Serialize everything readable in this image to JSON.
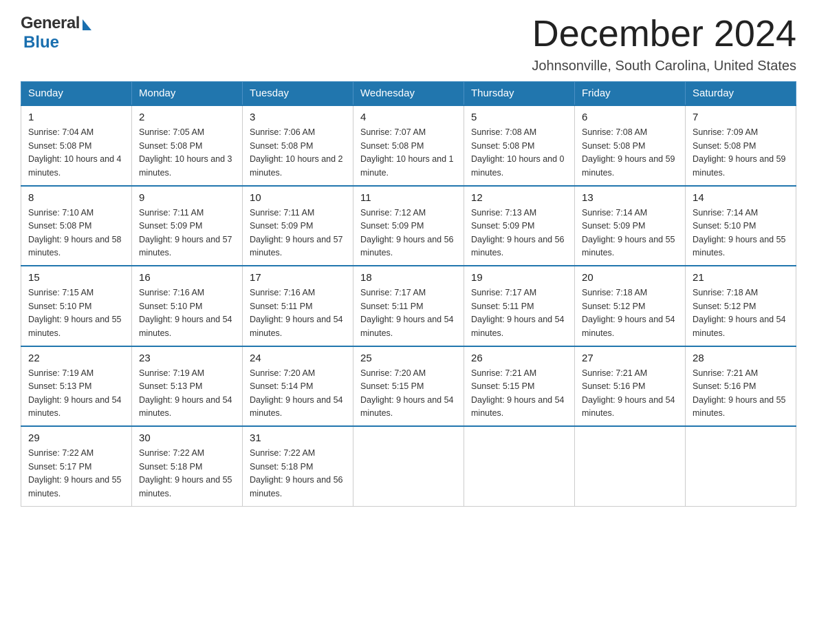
{
  "header": {
    "logo_general": "General",
    "logo_blue": "Blue",
    "month_year": "December 2024",
    "location": "Johnsonville, South Carolina, United States"
  },
  "weekdays": [
    "Sunday",
    "Monday",
    "Tuesday",
    "Wednesday",
    "Thursday",
    "Friday",
    "Saturday"
  ],
  "weeks": [
    [
      {
        "day": "1",
        "sunrise": "Sunrise: 7:04 AM",
        "sunset": "Sunset: 5:08 PM",
        "daylight": "Daylight: 10 hours and 4 minutes."
      },
      {
        "day": "2",
        "sunrise": "Sunrise: 7:05 AM",
        "sunset": "Sunset: 5:08 PM",
        "daylight": "Daylight: 10 hours and 3 minutes."
      },
      {
        "day": "3",
        "sunrise": "Sunrise: 7:06 AM",
        "sunset": "Sunset: 5:08 PM",
        "daylight": "Daylight: 10 hours and 2 minutes."
      },
      {
        "day": "4",
        "sunrise": "Sunrise: 7:07 AM",
        "sunset": "Sunset: 5:08 PM",
        "daylight": "Daylight: 10 hours and 1 minute."
      },
      {
        "day": "5",
        "sunrise": "Sunrise: 7:08 AM",
        "sunset": "Sunset: 5:08 PM",
        "daylight": "Daylight: 10 hours and 0 minutes."
      },
      {
        "day": "6",
        "sunrise": "Sunrise: 7:08 AM",
        "sunset": "Sunset: 5:08 PM",
        "daylight": "Daylight: 9 hours and 59 minutes."
      },
      {
        "day": "7",
        "sunrise": "Sunrise: 7:09 AM",
        "sunset": "Sunset: 5:08 PM",
        "daylight": "Daylight: 9 hours and 59 minutes."
      }
    ],
    [
      {
        "day": "8",
        "sunrise": "Sunrise: 7:10 AM",
        "sunset": "Sunset: 5:08 PM",
        "daylight": "Daylight: 9 hours and 58 minutes."
      },
      {
        "day": "9",
        "sunrise": "Sunrise: 7:11 AM",
        "sunset": "Sunset: 5:09 PM",
        "daylight": "Daylight: 9 hours and 57 minutes."
      },
      {
        "day": "10",
        "sunrise": "Sunrise: 7:11 AM",
        "sunset": "Sunset: 5:09 PM",
        "daylight": "Daylight: 9 hours and 57 minutes."
      },
      {
        "day": "11",
        "sunrise": "Sunrise: 7:12 AM",
        "sunset": "Sunset: 5:09 PM",
        "daylight": "Daylight: 9 hours and 56 minutes."
      },
      {
        "day": "12",
        "sunrise": "Sunrise: 7:13 AM",
        "sunset": "Sunset: 5:09 PM",
        "daylight": "Daylight: 9 hours and 56 minutes."
      },
      {
        "day": "13",
        "sunrise": "Sunrise: 7:14 AM",
        "sunset": "Sunset: 5:09 PM",
        "daylight": "Daylight: 9 hours and 55 minutes."
      },
      {
        "day": "14",
        "sunrise": "Sunrise: 7:14 AM",
        "sunset": "Sunset: 5:10 PM",
        "daylight": "Daylight: 9 hours and 55 minutes."
      }
    ],
    [
      {
        "day": "15",
        "sunrise": "Sunrise: 7:15 AM",
        "sunset": "Sunset: 5:10 PM",
        "daylight": "Daylight: 9 hours and 55 minutes."
      },
      {
        "day": "16",
        "sunrise": "Sunrise: 7:16 AM",
        "sunset": "Sunset: 5:10 PM",
        "daylight": "Daylight: 9 hours and 54 minutes."
      },
      {
        "day": "17",
        "sunrise": "Sunrise: 7:16 AM",
        "sunset": "Sunset: 5:11 PM",
        "daylight": "Daylight: 9 hours and 54 minutes."
      },
      {
        "day": "18",
        "sunrise": "Sunrise: 7:17 AM",
        "sunset": "Sunset: 5:11 PM",
        "daylight": "Daylight: 9 hours and 54 minutes."
      },
      {
        "day": "19",
        "sunrise": "Sunrise: 7:17 AM",
        "sunset": "Sunset: 5:11 PM",
        "daylight": "Daylight: 9 hours and 54 minutes."
      },
      {
        "day": "20",
        "sunrise": "Sunrise: 7:18 AM",
        "sunset": "Sunset: 5:12 PM",
        "daylight": "Daylight: 9 hours and 54 minutes."
      },
      {
        "day": "21",
        "sunrise": "Sunrise: 7:18 AM",
        "sunset": "Sunset: 5:12 PM",
        "daylight": "Daylight: 9 hours and 54 minutes."
      }
    ],
    [
      {
        "day": "22",
        "sunrise": "Sunrise: 7:19 AM",
        "sunset": "Sunset: 5:13 PM",
        "daylight": "Daylight: 9 hours and 54 minutes."
      },
      {
        "day": "23",
        "sunrise": "Sunrise: 7:19 AM",
        "sunset": "Sunset: 5:13 PM",
        "daylight": "Daylight: 9 hours and 54 minutes."
      },
      {
        "day": "24",
        "sunrise": "Sunrise: 7:20 AM",
        "sunset": "Sunset: 5:14 PM",
        "daylight": "Daylight: 9 hours and 54 minutes."
      },
      {
        "day": "25",
        "sunrise": "Sunrise: 7:20 AM",
        "sunset": "Sunset: 5:15 PM",
        "daylight": "Daylight: 9 hours and 54 minutes."
      },
      {
        "day": "26",
        "sunrise": "Sunrise: 7:21 AM",
        "sunset": "Sunset: 5:15 PM",
        "daylight": "Daylight: 9 hours and 54 minutes."
      },
      {
        "day": "27",
        "sunrise": "Sunrise: 7:21 AM",
        "sunset": "Sunset: 5:16 PM",
        "daylight": "Daylight: 9 hours and 54 minutes."
      },
      {
        "day": "28",
        "sunrise": "Sunrise: 7:21 AM",
        "sunset": "Sunset: 5:16 PM",
        "daylight": "Daylight: 9 hours and 55 minutes."
      }
    ],
    [
      {
        "day": "29",
        "sunrise": "Sunrise: 7:22 AM",
        "sunset": "Sunset: 5:17 PM",
        "daylight": "Daylight: 9 hours and 55 minutes."
      },
      {
        "day": "30",
        "sunrise": "Sunrise: 7:22 AM",
        "sunset": "Sunset: 5:18 PM",
        "daylight": "Daylight: 9 hours and 55 minutes."
      },
      {
        "day": "31",
        "sunrise": "Sunrise: 7:22 AM",
        "sunset": "Sunset: 5:18 PM",
        "daylight": "Daylight: 9 hours and 56 minutes."
      },
      null,
      null,
      null,
      null
    ]
  ]
}
